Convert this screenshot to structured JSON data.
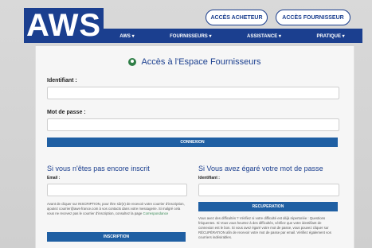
{
  "header": {
    "logo": "AWS",
    "buttons": {
      "buyer": "ACCÈS ACHETEUR",
      "supplier": "ACCÈS FOURNISSEUR"
    },
    "nav": [
      "AWS",
      "FOURNISSEURS",
      "ASSISTANCE",
      "PRATIQUE"
    ]
  },
  "form": {
    "title": "Accès à l'Espace Fournisseurs",
    "identifiant_label": "Identifiant :",
    "password_label": "Mot de passe :",
    "connect_button": "CONNEXION"
  },
  "register": {
    "title": "Si vous n'êtes pas encore inscrit",
    "email_label": "Email :",
    "text": "Avant de cliquer sur INSCRIPTION, pour être sûr(e) de recevoir votre courrier d'inscription, ajoutez courrier@aws-france.com à vos contacts dans votre messagerie. Si malgré cela vous ne recevez pas le courrier d'inscription, consultez la page",
    "link": "Correspondance",
    "button": "INSCRIPTION"
  },
  "recover": {
    "title": "Si Vous avez égaré votre mot de passe",
    "identifiant_label": "Identifiant :",
    "button": "RECUPERATION",
    "text": "Vous avez des difficultés ? Vérifiez si votre difficulté est déjà répertoriée : Questions fréquentes. Si Vous vous heurtez à des difficultés, vérifiez que votre identifiant de connexion est le bon. Si vous avez égaré votre mot de passe, vous pouvez cliquer sur RÉCUPÉRATION afin de recevoir votre mot de passe par email. Vérifiez également vos courriers indésirables."
  }
}
